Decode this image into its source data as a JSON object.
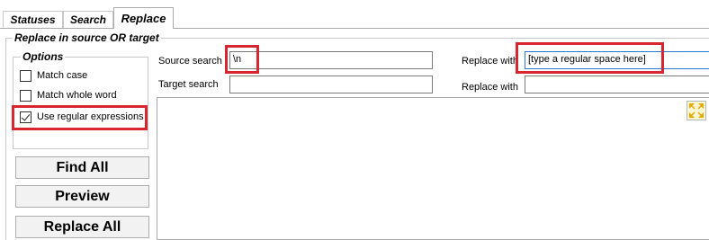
{
  "tabs": [
    {
      "label": "Statuses",
      "active": false
    },
    {
      "label": "Search",
      "active": false
    },
    {
      "label": "Replace",
      "active": true
    }
  ],
  "group": {
    "title": "Replace in source OR target"
  },
  "options": {
    "title": "Options",
    "items": [
      {
        "label": "Match case",
        "checked": false
      },
      {
        "label": "Match whole word",
        "checked": false
      },
      {
        "label": "Use regular expressions",
        "checked": true
      }
    ]
  },
  "buttons": {
    "find_all": "Find All",
    "preview": "Preview",
    "replace_all": "Replace All"
  },
  "fields": {
    "source_search": {
      "label": "Source search",
      "value": "\\n"
    },
    "target_search": {
      "label": "Target search",
      "value": ""
    },
    "replace_with_source": {
      "label": "Replace with",
      "value": "[type a regular space here]"
    },
    "replace_with_target": {
      "label": "Replace with",
      "value": ""
    }
  },
  "colors": {
    "highlight": "#d7262f",
    "accent_input_border": "#2b78d0"
  },
  "icons": {
    "expand": "expand-arrows-icon"
  }
}
